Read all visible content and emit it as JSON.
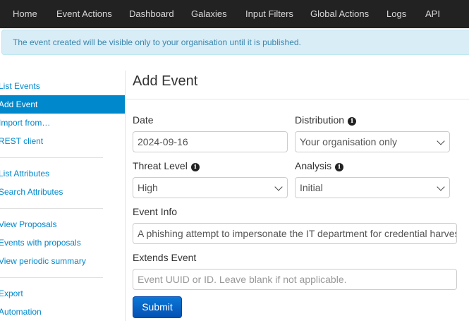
{
  "navbar": {
    "items": [
      "Home",
      "Event Actions",
      "Dashboard",
      "Galaxies",
      "Input Filters",
      "Global Actions",
      "Logs",
      "API"
    ]
  },
  "alert": {
    "text": "The event created will be visible only to your organisation until it is published."
  },
  "sidebar": {
    "items": [
      "List Events",
      "Add Event",
      "Import from…",
      "REST client",
      "List Attributes",
      "Search Attributes",
      "View Proposals",
      "Events with proposals",
      "View periodic summary",
      "Export",
      "Automation"
    ],
    "active": "Add Event"
  },
  "form": {
    "title": "Add Event",
    "date_label": "Date",
    "date_value": "2024-09-16",
    "distribution_label": "Distribution",
    "distribution_value": "Your organisation only",
    "threat_level_label": "Threat Level",
    "threat_level_value": "High",
    "analysis_label": "Analysis",
    "analysis_value": "Initial",
    "event_info_label": "Event Info",
    "event_info_value": "A phishing attempt to impersonate the IT department for credential harvesting",
    "extends_label": "Extends Event",
    "extends_placeholder": "Event UUID or ID. Leave blank if not applicable.",
    "submit_label": "Submit"
  },
  "icons": {
    "info": "info-circle-icon",
    "dropdown": "chevron-down-icon"
  },
  "colors": {
    "navbar": "#222222",
    "link": "#0088cc",
    "alert_bg": "#d9edf7",
    "alert_text": "#3a87ad",
    "submit": "#0450b4"
  }
}
